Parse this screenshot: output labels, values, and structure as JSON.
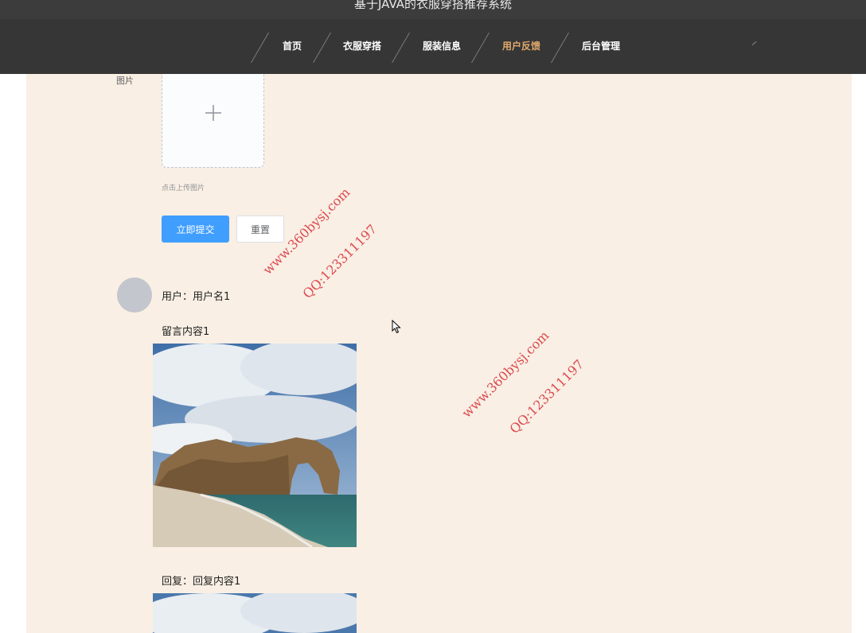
{
  "header": {
    "site_title": "基于JAVA的衣服穿搭推荐系统",
    "nav": [
      {
        "label": "首页",
        "active": false
      },
      {
        "label": "衣服穿搭",
        "active": false
      },
      {
        "label": "服装信息",
        "active": false
      },
      {
        "label": "用户反馈",
        "active": true
      },
      {
        "label": "后台管理",
        "active": false
      }
    ],
    "active_color": "#e2a96b"
  },
  "form": {
    "image_label": "图片",
    "upload_icon": "plus-icon",
    "upload_tip": "点击上传图片",
    "submit_label": "立即提交",
    "reset_label": "重置"
  },
  "feedback": {
    "user_line": "用户：用户名1",
    "message": "留言内容1",
    "reply": "回复：回复内容1",
    "image_description": "photo"
  },
  "watermarks": [
    {
      "site": "www.360bysj.com",
      "qq": "QQ:123311197"
    },
    {
      "site": "www.360bysj.com",
      "qq": "QQ:123311197"
    }
  ],
  "colors": {
    "header_bg": "#363636",
    "content_bg": "#f9efe4",
    "primary": "#409eff",
    "watermark": "#d9363e"
  }
}
